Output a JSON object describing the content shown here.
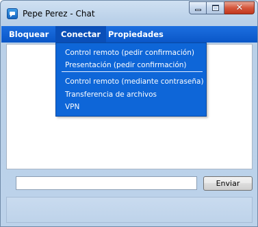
{
  "window": {
    "title": "Pepe Perez - Chat"
  },
  "menubar": {
    "items": [
      {
        "label": "Bloquear"
      },
      {
        "label": "Conectar",
        "active": true
      },
      {
        "label": "Propiedades"
      }
    ]
  },
  "connect_menu": {
    "items": [
      {
        "label": "Control remoto (pedir confirmación)"
      },
      {
        "label": "Presentación (pedir confirmación)"
      },
      {
        "label": "Control remoto (mediante contraseña)"
      },
      {
        "label": "Transferencia de archivos"
      },
      {
        "label": "VPN"
      }
    ]
  },
  "compose": {
    "input_value": "",
    "send_label": "Enviar"
  },
  "colors": {
    "menubar": "#0a57c8",
    "dropdown": "#0e66d8"
  }
}
